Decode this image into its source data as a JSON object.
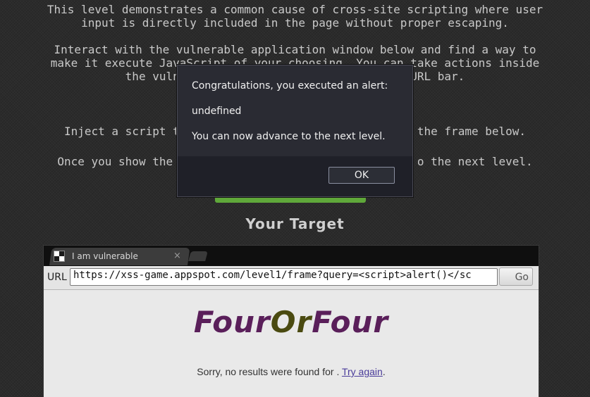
{
  "intro": {
    "paragraph1": "This level demonstrates a common cause of cross-site scripting where user\ninput is directly included in the page without proper escaping.",
    "paragraph2": "Interact with the vulnerable application window below and find a way to\nmake it execute JavaScript of your choosing. You can take actions inside\nthe vulne                                 URL bar.",
    "paragraph3": "Inject a script t                                   the frame below.",
    "paragraph4": "Once you show the a                                  o the next level."
  },
  "target_title": "Your Target",
  "browser": {
    "tab_title": "I am vulnerable",
    "tab_close": "×",
    "url_label": "URL",
    "url_value": "https://xss-game.appspot.com/level1/frame?query=<script>alert()</sc",
    "go_label": "Go"
  },
  "page": {
    "logo_part1": "Four",
    "logo_part2": "Or",
    "logo_part3": "Four",
    "result_prefix": "Sorry, no results were found for . ",
    "try_again": "Try again",
    "result_suffix": "."
  },
  "dialog": {
    "line1": "Congratulations, you executed an alert:",
    "line2": "undefined",
    "line3": "You can now advance to the next level.",
    "ok_label": "OK"
  },
  "colors": {
    "background": "#2b2b2b",
    "accent_green": "#5fa83a",
    "logo_purple": "#5a1f5a",
    "logo_olive": "#4a4a10"
  },
  "icons": [
    "favicon-icon",
    "close-icon"
  ]
}
